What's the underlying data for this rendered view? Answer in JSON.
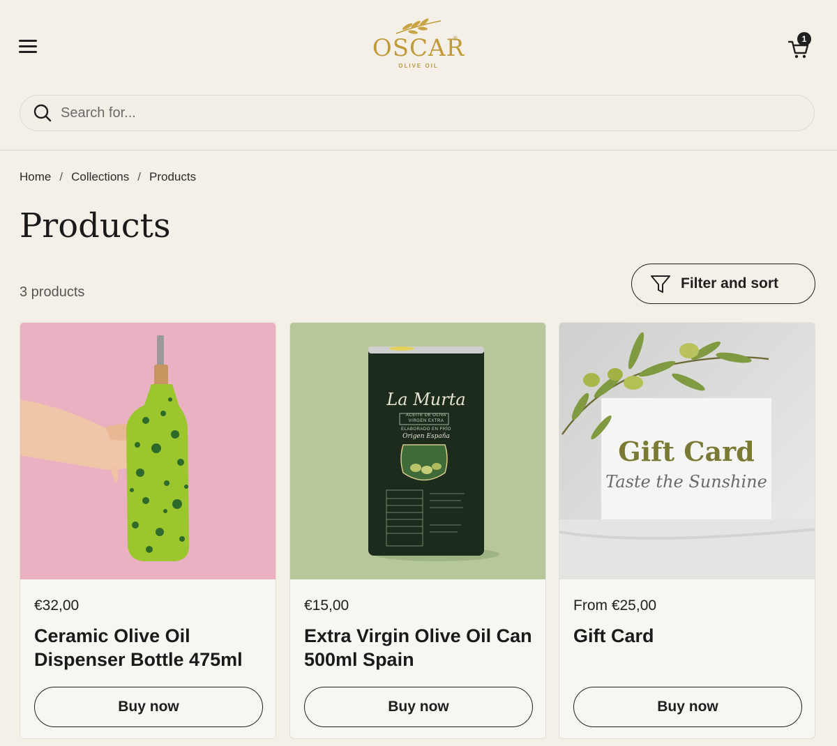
{
  "header": {
    "brand": "OSCAR",
    "brand_sub": "OLIVE OIL",
    "brand_mark": "®",
    "cart_count": "1"
  },
  "search": {
    "placeholder": "Search for..."
  },
  "breadcrumb": {
    "items": [
      "Home",
      "Collections",
      "Products"
    ],
    "separator": "/"
  },
  "page": {
    "title": "Products",
    "count": "3 products",
    "filter_label": "Filter and sort"
  },
  "products": [
    {
      "price": "€32,00",
      "title": "Ceramic Olive Oil Dispenser Bottle 475ml",
      "button": "Buy now"
    },
    {
      "price": "€15,00",
      "title": "Extra Virgin Olive Oil Can 500ml Spain",
      "button": "Buy now",
      "can_label": {
        "brand": "La Murta",
        "line1": "ACEITE DE OLIVA",
        "line2": "VIRGEN EXTRA",
        "line3": "ELABORADO EN FRÍO",
        "line4": "Origen España"
      }
    },
    {
      "price": "From €25,00",
      "title": "Gift Card",
      "button": "Buy now",
      "card_label": {
        "title": "Gift Card",
        "tagline": "Taste the Sunshine"
      }
    }
  ],
  "colors": {
    "background": "#f4f0e7",
    "brand_gold": "#c19a3a",
    "card_bg": "#f7f6f2",
    "image_pink": "#eab1c2",
    "image_sage": "#b6c89a",
    "bottle_green": "#9cc62e"
  }
}
